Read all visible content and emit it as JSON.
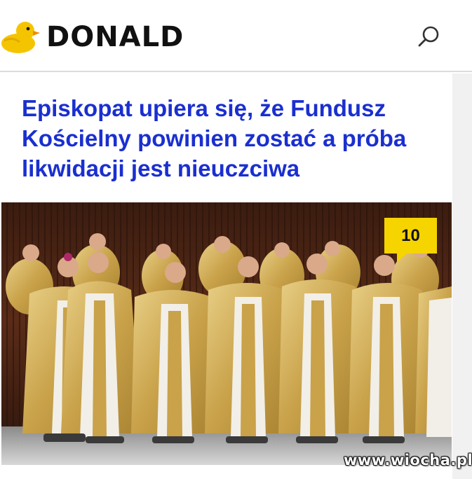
{
  "header": {
    "logo_text": "DONALD",
    "logo_icon": "duck-icon",
    "search_icon": "search-icon"
  },
  "article": {
    "title": "Episkopat upiera się, że Fundusz Kościelny powinien zostać a próba likwidacji jest nieuczciwa",
    "comment_count": "10",
    "image_alt": "bishops-in-gold-vestments-photo"
  },
  "watermark": {
    "text": "www.wiocha.pl"
  },
  "colors": {
    "headline": "#1a2fd0",
    "badge": "#f6d400",
    "logo_duck": "#f5c400"
  }
}
